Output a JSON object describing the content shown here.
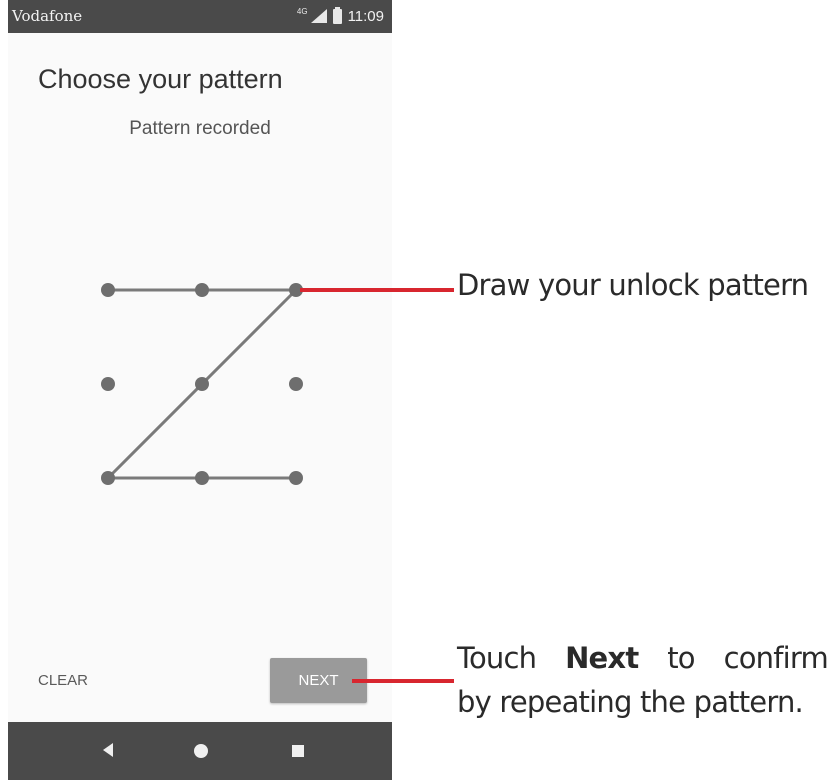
{
  "status_bar": {
    "carrier": "Vodafone",
    "network": "4G",
    "time": "11:09"
  },
  "screen": {
    "title": "Choose your pattern",
    "subtitle": "Pattern recorded"
  },
  "footer": {
    "clear_label": "CLEAR",
    "next_label": "NEXT"
  },
  "annotations": {
    "draw": "Draw your unlock pattern",
    "next_w1": "Touch",
    "next_w2": "Next",
    "next_w3": "to",
    "next_w4": "confirm",
    "next_line2": "by repeating the pattern."
  },
  "colors": {
    "status_bar": "#4a4a4a",
    "nav_bar": "#4a4a4a",
    "pattern_dot": "#6e6e6e",
    "pattern_line": "#7a7a7a",
    "next_button": "#9a9a9a",
    "annotation_line": "#d8262f"
  },
  "icons": {
    "signal": "signal-icon",
    "battery": "battery-icon",
    "back": "back-icon",
    "home": "home-icon",
    "recents": "recents-icon"
  }
}
